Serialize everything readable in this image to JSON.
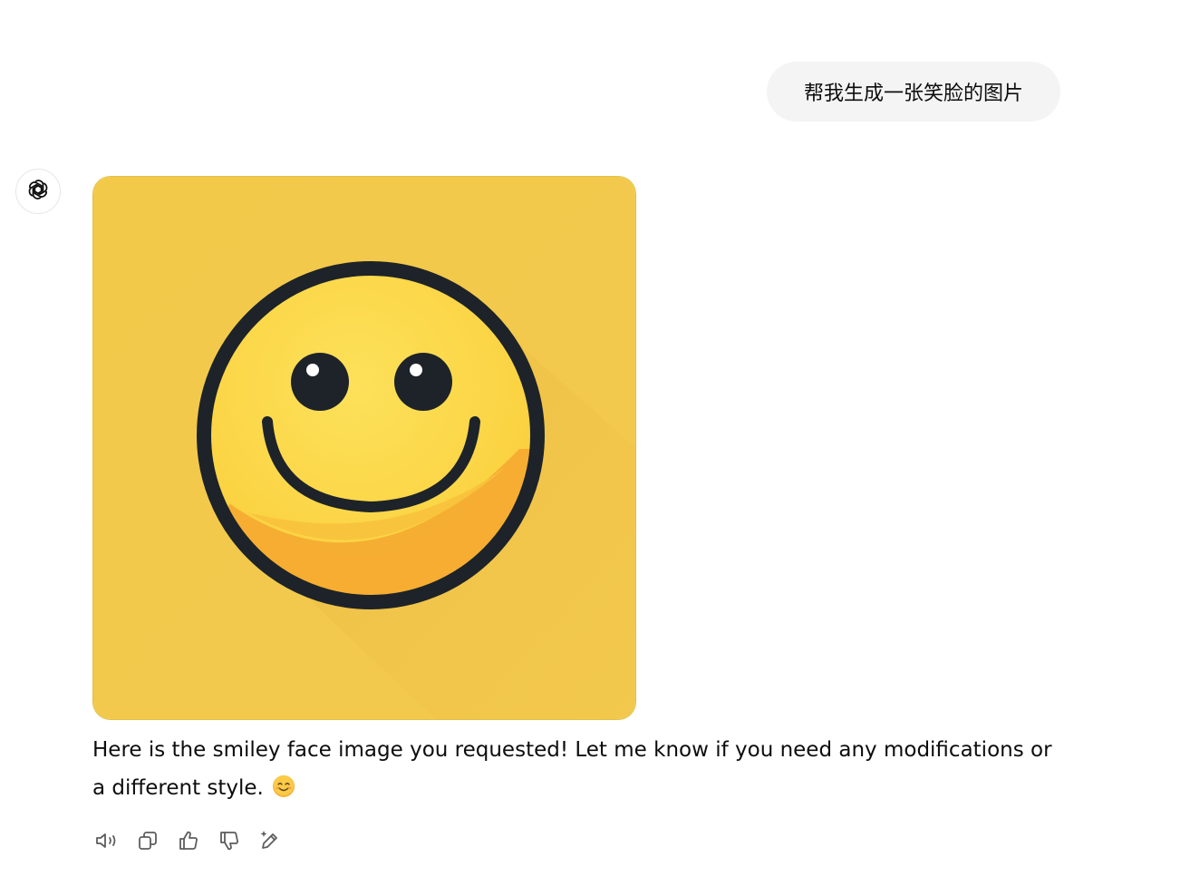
{
  "conversation": {
    "user_message": {
      "text": "帮我生成一张笑脸的图片"
    },
    "assistant_message": {
      "avatar_icon": "openai-logo-icon",
      "image": {
        "subject": "smiley-face-image",
        "background_color": "#f5cd4a",
        "face_color": "#fbd94a",
        "outline_color": "#1d2329",
        "highlight_color": "#f29a2e"
      },
      "text": "Here is the smiley face image you requested! Let me know if you need any modifications or a different style.",
      "emoji_icon": "smiling-face-emoji-icon"
    },
    "actions": [
      {
        "icon": "read-aloud-icon"
      },
      {
        "icon": "copy-icon"
      },
      {
        "icon": "thumbs-up-icon"
      },
      {
        "icon": "thumbs-down-icon"
      },
      {
        "icon": "edit-sparkle-icon"
      }
    ]
  },
  "colors": {
    "bubble_bg": "#f4f4f4",
    "text": "#0d0d0d",
    "icon": "#5d5d5d"
  }
}
